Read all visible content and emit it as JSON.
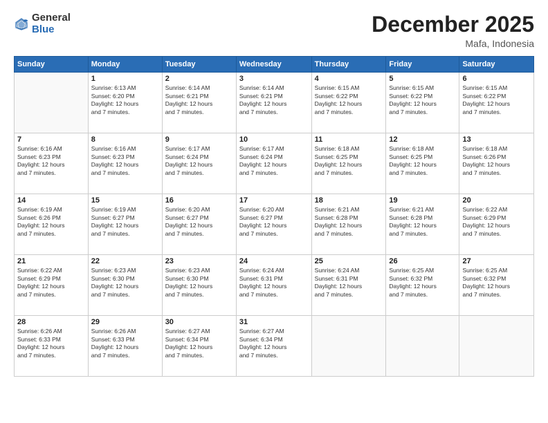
{
  "logo": {
    "general": "General",
    "blue": "Blue"
  },
  "header": {
    "month": "December 2025",
    "location": "Mafa, Indonesia"
  },
  "weekdays": [
    "Sunday",
    "Monday",
    "Tuesday",
    "Wednesday",
    "Thursday",
    "Friday",
    "Saturday"
  ],
  "weeks": [
    [
      {
        "day": "",
        "info": ""
      },
      {
        "day": "1",
        "info": "Sunrise: 6:13 AM\nSunset: 6:20 PM\nDaylight: 12 hours\nand 7 minutes."
      },
      {
        "day": "2",
        "info": "Sunrise: 6:14 AM\nSunset: 6:21 PM\nDaylight: 12 hours\nand 7 minutes."
      },
      {
        "day": "3",
        "info": "Sunrise: 6:14 AM\nSunset: 6:21 PM\nDaylight: 12 hours\nand 7 minutes."
      },
      {
        "day": "4",
        "info": "Sunrise: 6:15 AM\nSunset: 6:22 PM\nDaylight: 12 hours\nand 7 minutes."
      },
      {
        "day": "5",
        "info": "Sunrise: 6:15 AM\nSunset: 6:22 PM\nDaylight: 12 hours\nand 7 minutes."
      },
      {
        "day": "6",
        "info": "Sunrise: 6:15 AM\nSunset: 6:22 PM\nDaylight: 12 hours\nand 7 minutes."
      }
    ],
    [
      {
        "day": "7",
        "info": "Sunrise: 6:16 AM\nSunset: 6:23 PM\nDaylight: 12 hours\nand 7 minutes."
      },
      {
        "day": "8",
        "info": "Sunrise: 6:16 AM\nSunset: 6:23 PM\nDaylight: 12 hours\nand 7 minutes."
      },
      {
        "day": "9",
        "info": "Sunrise: 6:17 AM\nSunset: 6:24 PM\nDaylight: 12 hours\nand 7 minutes."
      },
      {
        "day": "10",
        "info": "Sunrise: 6:17 AM\nSunset: 6:24 PM\nDaylight: 12 hours\nand 7 minutes."
      },
      {
        "day": "11",
        "info": "Sunrise: 6:18 AM\nSunset: 6:25 PM\nDaylight: 12 hours\nand 7 minutes."
      },
      {
        "day": "12",
        "info": "Sunrise: 6:18 AM\nSunset: 6:25 PM\nDaylight: 12 hours\nand 7 minutes."
      },
      {
        "day": "13",
        "info": "Sunrise: 6:18 AM\nSunset: 6:26 PM\nDaylight: 12 hours\nand 7 minutes."
      }
    ],
    [
      {
        "day": "14",
        "info": "Sunrise: 6:19 AM\nSunset: 6:26 PM\nDaylight: 12 hours\nand 7 minutes."
      },
      {
        "day": "15",
        "info": "Sunrise: 6:19 AM\nSunset: 6:27 PM\nDaylight: 12 hours\nand 7 minutes."
      },
      {
        "day": "16",
        "info": "Sunrise: 6:20 AM\nSunset: 6:27 PM\nDaylight: 12 hours\nand 7 minutes."
      },
      {
        "day": "17",
        "info": "Sunrise: 6:20 AM\nSunset: 6:27 PM\nDaylight: 12 hours\nand 7 minutes."
      },
      {
        "day": "18",
        "info": "Sunrise: 6:21 AM\nSunset: 6:28 PM\nDaylight: 12 hours\nand 7 minutes."
      },
      {
        "day": "19",
        "info": "Sunrise: 6:21 AM\nSunset: 6:28 PM\nDaylight: 12 hours\nand 7 minutes."
      },
      {
        "day": "20",
        "info": "Sunrise: 6:22 AM\nSunset: 6:29 PM\nDaylight: 12 hours\nand 7 minutes."
      }
    ],
    [
      {
        "day": "21",
        "info": "Sunrise: 6:22 AM\nSunset: 6:29 PM\nDaylight: 12 hours\nand 7 minutes."
      },
      {
        "day": "22",
        "info": "Sunrise: 6:23 AM\nSunset: 6:30 PM\nDaylight: 12 hours\nand 7 minutes."
      },
      {
        "day": "23",
        "info": "Sunrise: 6:23 AM\nSunset: 6:30 PM\nDaylight: 12 hours\nand 7 minutes."
      },
      {
        "day": "24",
        "info": "Sunrise: 6:24 AM\nSunset: 6:31 PM\nDaylight: 12 hours\nand 7 minutes."
      },
      {
        "day": "25",
        "info": "Sunrise: 6:24 AM\nSunset: 6:31 PM\nDaylight: 12 hours\nand 7 minutes."
      },
      {
        "day": "26",
        "info": "Sunrise: 6:25 AM\nSunset: 6:32 PM\nDaylight: 12 hours\nand 7 minutes."
      },
      {
        "day": "27",
        "info": "Sunrise: 6:25 AM\nSunset: 6:32 PM\nDaylight: 12 hours\nand 7 minutes."
      }
    ],
    [
      {
        "day": "28",
        "info": "Sunrise: 6:26 AM\nSunset: 6:33 PM\nDaylight: 12 hours\nand 7 minutes."
      },
      {
        "day": "29",
        "info": "Sunrise: 6:26 AM\nSunset: 6:33 PM\nDaylight: 12 hours\nand 7 minutes."
      },
      {
        "day": "30",
        "info": "Sunrise: 6:27 AM\nSunset: 6:34 PM\nDaylight: 12 hours\nand 7 minutes."
      },
      {
        "day": "31",
        "info": "Sunrise: 6:27 AM\nSunset: 6:34 PM\nDaylight: 12 hours\nand 7 minutes."
      },
      {
        "day": "",
        "info": ""
      },
      {
        "day": "",
        "info": ""
      },
      {
        "day": "",
        "info": ""
      }
    ]
  ]
}
